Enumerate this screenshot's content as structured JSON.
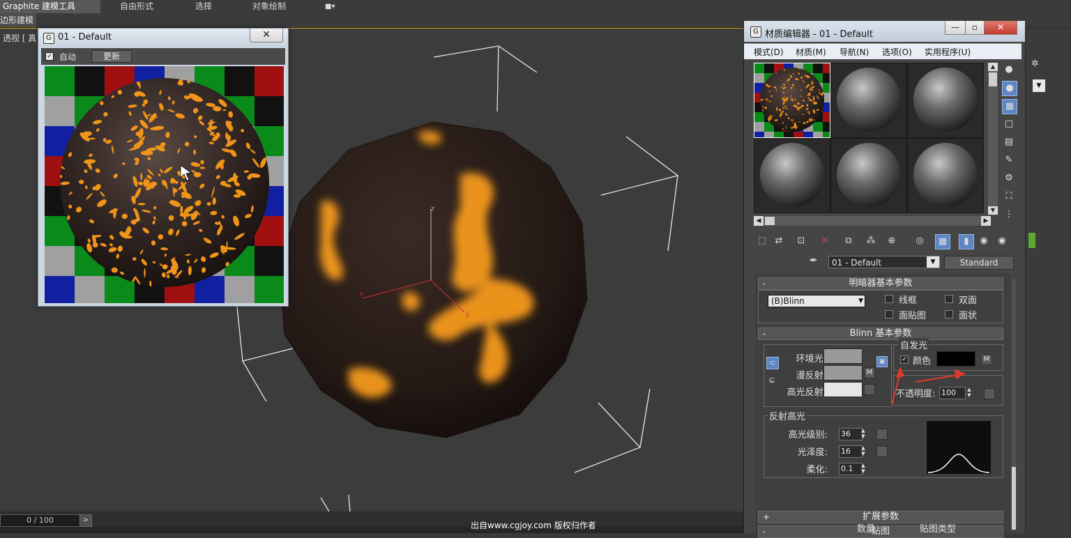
{
  "ribbon": {
    "tabs": [
      "Graphite 建模工具",
      "自由形式",
      "选择",
      "对象绘制"
    ],
    "subtab": "边形建模"
  },
  "viewport": {
    "label": "透视 [ 真",
    "axes": {
      "x": "x",
      "y": "y",
      "z": "z"
    }
  },
  "timeline": {
    "slider": "0 / 100",
    "next": ">"
  },
  "watermark": "出自www.cgjoy.com 版权归作者",
  "preview_window": {
    "title": "01 - Default",
    "close": "✕",
    "auto_checked": true,
    "auto_label": "自动",
    "update_button": "更新"
  },
  "material_editor": {
    "title": "材质编辑器 - 01 - Default",
    "menus": [
      "模式(D)",
      "材质(M)",
      "导航(N)",
      "选项(O)",
      "实用程序(U)"
    ],
    "material_name": "01 - Default",
    "material_type": "Standard",
    "shader_rollout": {
      "title": "明暗器基本参数",
      "shader": "(B)Blinn",
      "wire_label": "线框",
      "two_sided_label": "双面",
      "face_map_label": "面贴图",
      "faceted_label": "面状"
    },
    "blinn_rollout": {
      "title": "Blinn 基本参数",
      "ambient_label": "环境光:",
      "diffuse_label": "漫反射:",
      "specular_label": "高光反射:",
      "self_illum_group": "自发光",
      "self_illum_color_checked": true,
      "self_illum_color_label": "颜色",
      "opacity_label": "不透明度:",
      "opacity_value": "100",
      "m_label": "M"
    },
    "specular_highlights": {
      "group": "反射高光",
      "level_label": "高光级别:",
      "level_value": "36",
      "gloss_label": "光泽度:",
      "gloss_value": "16",
      "soften_label": "柔化:",
      "soften_value": "0.1"
    },
    "extended_rollout": "扩展参数",
    "maps_rollout": {
      "title": "贴图",
      "col_amount": "数量",
      "col_map_type": "贴图类型"
    },
    "colors": {
      "ambient": "#9a9a9a",
      "diffuse": "#9a9a9a",
      "specular": "#e6e6e6",
      "self_illum": "#000000"
    }
  }
}
